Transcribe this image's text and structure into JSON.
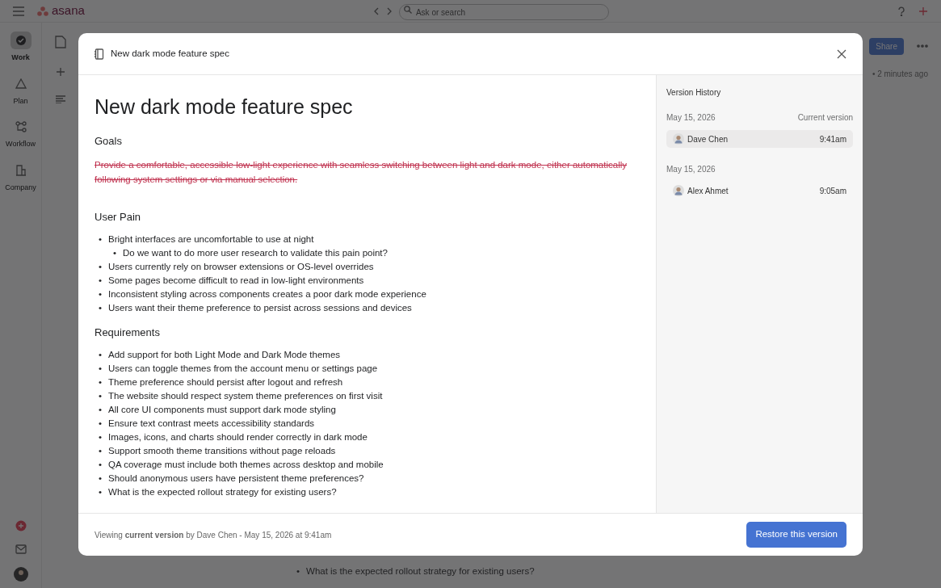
{
  "app": {
    "logo": "asana",
    "search": {
      "placeholder": "Ask or search"
    },
    "nav": [
      {
        "label": "Work",
        "selected": true
      },
      {
        "label": "Plan",
        "selected": false
      },
      {
        "label": "Workflow",
        "selected": false
      },
      {
        "label": "Company",
        "selected": false
      }
    ],
    "bullet": "•",
    "share_button": "Share",
    "updated": "• 2 minutes ago",
    "behind_bullets": [
      "What is the expected rollout strategy for existing users?"
    ]
  },
  "modal": {
    "title": "New dark mode feature spec",
    "doc": {
      "heading": "New dark mode feature spec",
      "bullet": "•",
      "sections": [
        {
          "heading": "Goals",
          "kind": "paragraph",
          "struck": true,
          "text": "Provide a comfortable, accessible low-light experience with seamless switching between light and dark mode, either automatically following system settings or via manual selection."
        },
        {
          "heading": "User Pain",
          "kind": "list",
          "items": [
            {
              "text": "Bright interfaces are uncomfortable to use at night",
              "children": [
                {
                  "text": "Do we want to do more user research to validate this pain point?"
                }
              ]
            },
            {
              "text": "Users currently rely on browser extensions or OS-level overrides"
            },
            {
              "text": "Some pages become difficult to read in low-light environments"
            },
            {
              "text": "Inconsistent styling across components creates a poor dark mode experience"
            },
            {
              "text": "Users want their theme preference to persist across sessions and devices"
            }
          ]
        },
        {
          "heading": "Requirements",
          "kind": "list",
          "items": [
            {
              "text": "Add support for both Light Mode and Dark Mode themes"
            },
            {
              "text": "Users can toggle themes from the account menu or settings page"
            },
            {
              "text": "Theme preference should persist after logout and refresh"
            },
            {
              "text": "The website should respect system theme preferences on first visit"
            },
            {
              "text": "All core UI components must support dark mode styling"
            },
            {
              "text": "Ensure text contrast meets accessibility standards"
            },
            {
              "text": "Images, icons, and charts should render correctly in dark mode"
            },
            {
              "text": "Support smooth theme transitions without page reloads"
            },
            {
              "text": "QA coverage must include both themes across desktop and mobile"
            },
            {
              "text": "Should anonymous users have persistent theme preferences?"
            },
            {
              "text": "What is the expected rollout strategy for existing users?"
            }
          ]
        }
      ]
    },
    "version_history": {
      "title": "Version History",
      "groups": [
        {
          "date": "May 15, 2026",
          "label": "Current version",
          "versions": [
            {
              "author": "Dave Chen",
              "time": "9:41am",
              "selected": true
            }
          ]
        },
        {
          "date": "May 15, 2026",
          "versions": [
            {
              "author": "Alex Ahmet",
              "time": "9:05am",
              "selected": false
            }
          ]
        }
      ]
    },
    "footer": {
      "status": "Viewing **current version** by Dave Chen - May 15, 2026 at 9:41am",
      "button": "Restore this version"
    }
  }
}
